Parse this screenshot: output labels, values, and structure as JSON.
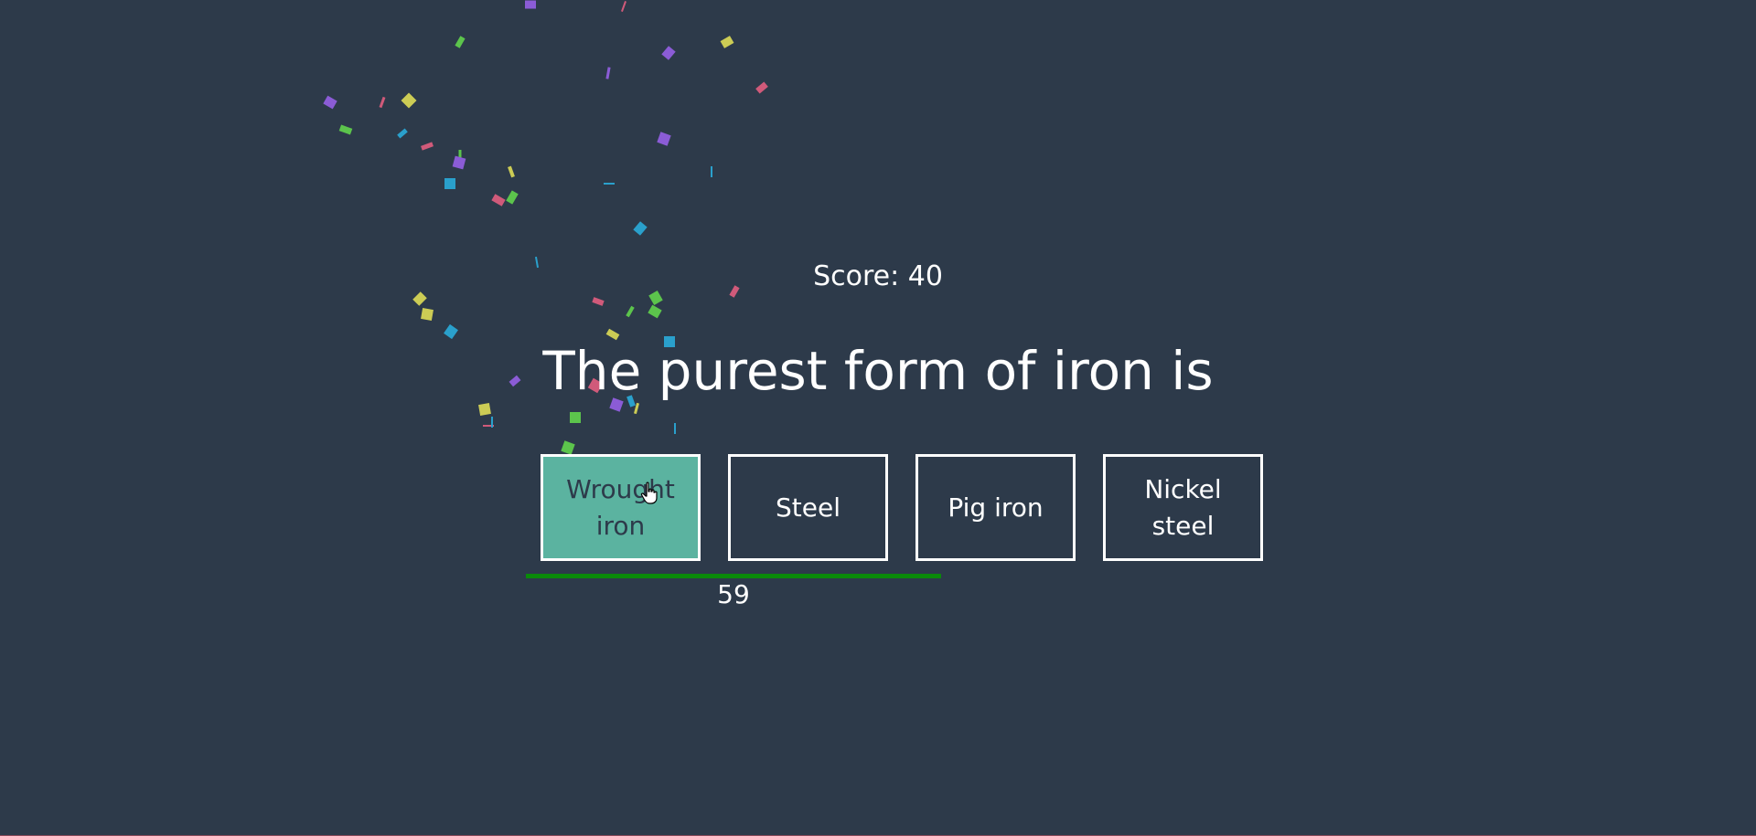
{
  "game": {
    "score_text": "Score: 40",
    "question": "The purest form of iron is",
    "answers": [
      "Wrought iron",
      "Steel",
      "Pig iron",
      "Nickel steel"
    ],
    "selected_index": 0,
    "timer": {
      "value_text": "59",
      "fraction_remaining": 1.0
    }
  },
  "colors": {
    "background": "#2d3a4a",
    "selected_answer": "#5bb3a0",
    "timer_bar": "#0a8a0a",
    "confetti": [
      "#8b5cd6",
      "#5cc44c",
      "#cccc55",
      "#d05a7a",
      "#2aa0cc"
    ]
  },
  "icons": {
    "cursor": "hand-pointer-icon",
    "confetti": "confetti-icon"
  }
}
